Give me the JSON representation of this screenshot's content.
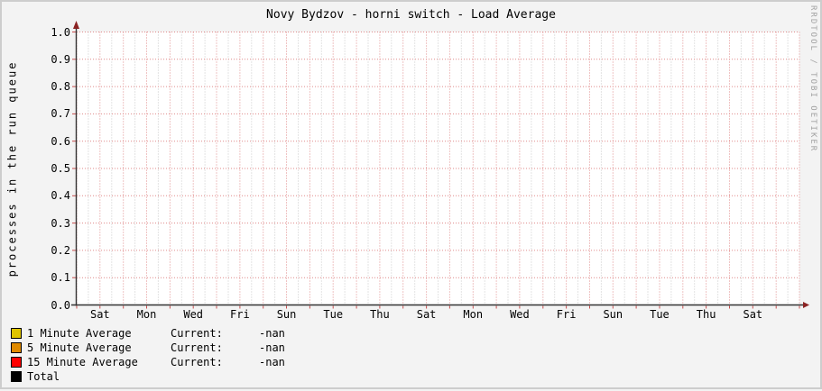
{
  "title": "Novy Bydzov - horni switch - Load Average",
  "watermark": "RRDTOOL / TOBI OETIKER",
  "colors": {
    "page_bg": "#f3f3f3",
    "page_border": "#cdcdcd",
    "plot_bg": "#ffffff",
    "axis": "#333333",
    "arrow": "#8b2323",
    "tick": "#c84c4c"
  },
  "chart_data": {
    "type": "line",
    "title": "Novy Bydzov - horni switch - Load Average",
    "ylabel": "processes in the run queue",
    "xlabel": "",
    "ylim": [
      0.0,
      1.0
    ],
    "y_tick_step": 0.1,
    "y_tick_labels": [
      "0.0",
      "0.1",
      "0.2",
      "0.3",
      "0.4",
      "0.5",
      "0.6",
      "0.7",
      "0.8",
      "0.9",
      "1.0"
    ],
    "x_span_days": 31,
    "x_tick_days": [
      1,
      3,
      5,
      7,
      9,
      11,
      13,
      15,
      17,
      19,
      21,
      23,
      25,
      27,
      29
    ],
    "x_tick_labels": [
      "Sat",
      "Mon",
      "Wed",
      "Fri",
      "Sun",
      "Tue",
      "Thu",
      "Sat",
      "Mon",
      "Wed",
      "Fri",
      "Sun",
      "Tue",
      "Thu",
      "Sat"
    ],
    "grid": {
      "style": "dotted",
      "major_color": "#e08a8a",
      "minor_color": "#c8c8c8",
      "major_v_interval_days": 1,
      "minor_v_interval_days": 0.5
    },
    "legend_position": "bottom-left",
    "series": [
      {
        "name": "1 Minute Average",
        "color": "#e0c500",
        "current_label": "Current:",
        "current": "-nan",
        "values": []
      },
      {
        "name": "5 Minute Average",
        "color": "#e08a00",
        "current_label": "Current:",
        "current": "-nan",
        "values": []
      },
      {
        "name": "15 Minute Average",
        "color": "#ff0000",
        "current_label": "Current:",
        "current": "-nan",
        "values": []
      },
      {
        "name": "Total",
        "color": "#000000",
        "current_label": "",
        "current": "",
        "values": []
      }
    ]
  }
}
